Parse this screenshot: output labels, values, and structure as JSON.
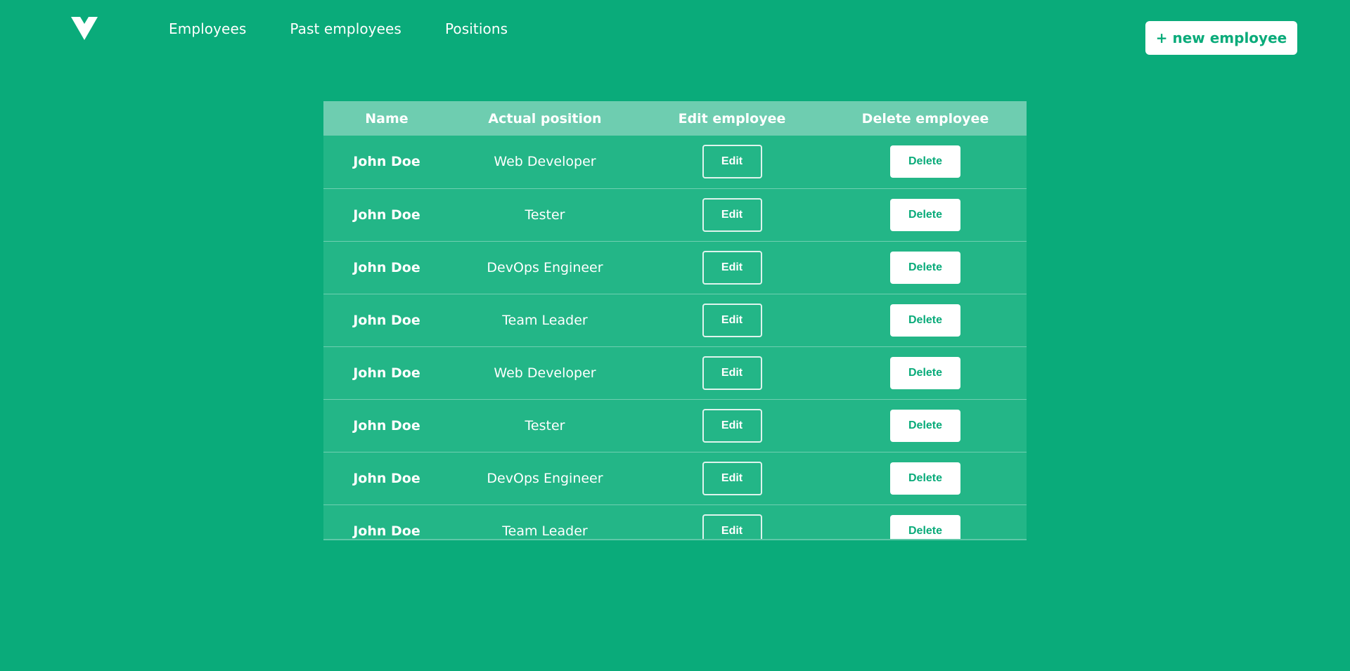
{
  "nav": {
    "logo_icon": "vue-v-logo-icon",
    "links": [
      "Employees",
      "Past employees",
      "Positions"
    ]
  },
  "header": {
    "new_employee_label": "+ new employee"
  },
  "table": {
    "columns": [
      "Name",
      "Actual position",
      "Edit employee",
      "Delete employee"
    ],
    "edit_label": "Edit",
    "delete_label": "Delete",
    "rows": [
      {
        "name": "John Doe",
        "position": "Web Developer"
      },
      {
        "name": "John Doe",
        "position": "Tester"
      },
      {
        "name": "John Doe",
        "position": "DevOps Engineer"
      },
      {
        "name": "John Doe",
        "position": "Team Leader"
      },
      {
        "name": "John Doe",
        "position": "Web Developer"
      },
      {
        "name": "John Doe",
        "position": "Tester"
      },
      {
        "name": "John Doe",
        "position": "DevOps Engineer"
      },
      {
        "name": "John Doe",
        "position": "Team Leader"
      }
    ]
  },
  "colors": {
    "background": "#0aab7a",
    "table_header": "#6ecdb0",
    "table_row": "#23b687",
    "button_text": "#0aab7a"
  }
}
